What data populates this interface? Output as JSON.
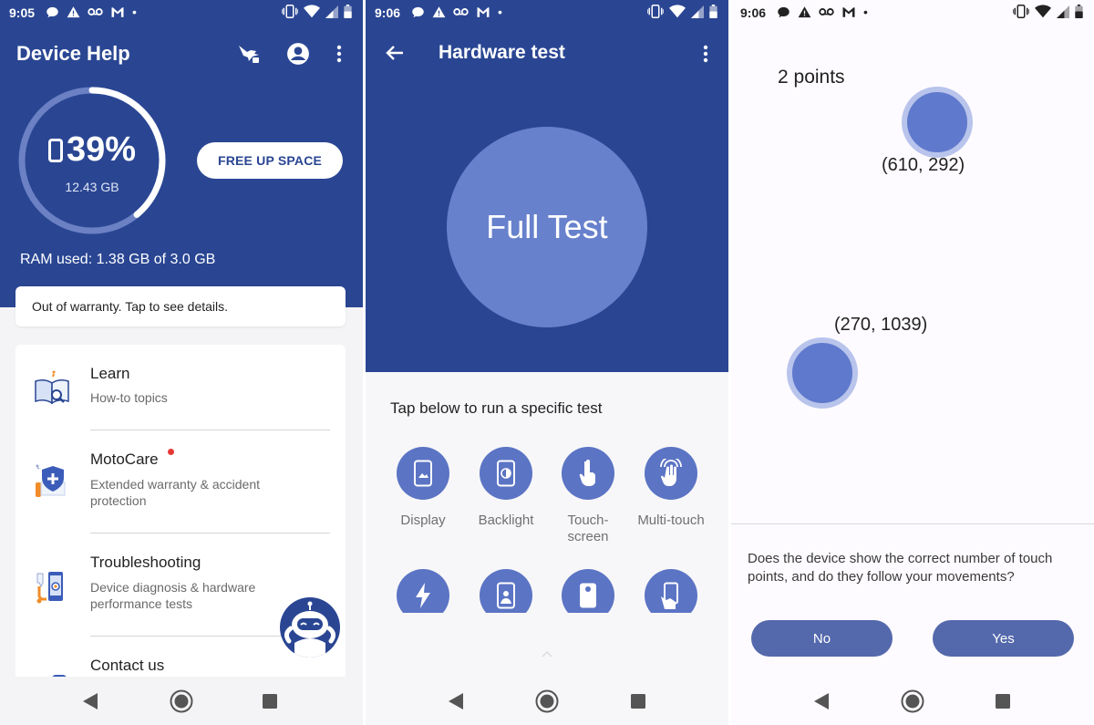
{
  "status_bars": [
    {
      "time": "9:05"
    },
    {
      "time": "9:06"
    },
    {
      "time": "9:06"
    }
  ],
  "device_help": {
    "title": "Device Help",
    "storage_percent": "39%",
    "storage_fraction": 0.39,
    "storage_size": "12.43 GB",
    "free_up_label": "FREE UP SPACE",
    "ram_used": "RAM used: 1.38 GB of 3.0 GB",
    "warranty_text": "Out of warranty. Tap to see details.",
    "menu_items": [
      {
        "title": "Learn",
        "subtitle": "How-to topics"
      },
      {
        "title": "MotoCare",
        "subtitle": "Extended warranty & accident protection"
      },
      {
        "title": "Troubleshooting",
        "subtitle": "Device diagnosis & hardware performance tests"
      },
      {
        "title": "Contact us",
        "subtitle": ""
      }
    ]
  },
  "hardware_test": {
    "title": "Hardware test",
    "full_test_label": "Full Test",
    "tap_below": "Tap below to run a specific test",
    "tests": [
      {
        "label": "Display",
        "icon": "display-icon"
      },
      {
        "label": "Backlight",
        "icon": "backlight-icon"
      },
      {
        "label": "Touch-\nscreen",
        "icon": "touchscreen-icon"
      },
      {
        "label": "Multi-touch",
        "icon": "multi-touch-icon"
      }
    ],
    "tests_row2_icons": [
      "flash-icon",
      "front-camera-icon",
      "rear-camera-icon",
      "hand-hold-icon"
    ]
  },
  "touch_test": {
    "points_label": "2 points",
    "points": [
      {
        "coord": "(610, 292)"
      },
      {
        "coord": "(270, 1039)"
      }
    ],
    "question": "Does the device show the correct number of touch points, and do they follow your movements?",
    "no_label": "No",
    "yes_label": "Yes"
  },
  "colors": {
    "brand_blue": "#2a4693",
    "accent_circle": "#6881cc",
    "button_blue": "#5468ac",
    "notification_red": "#e53935"
  }
}
